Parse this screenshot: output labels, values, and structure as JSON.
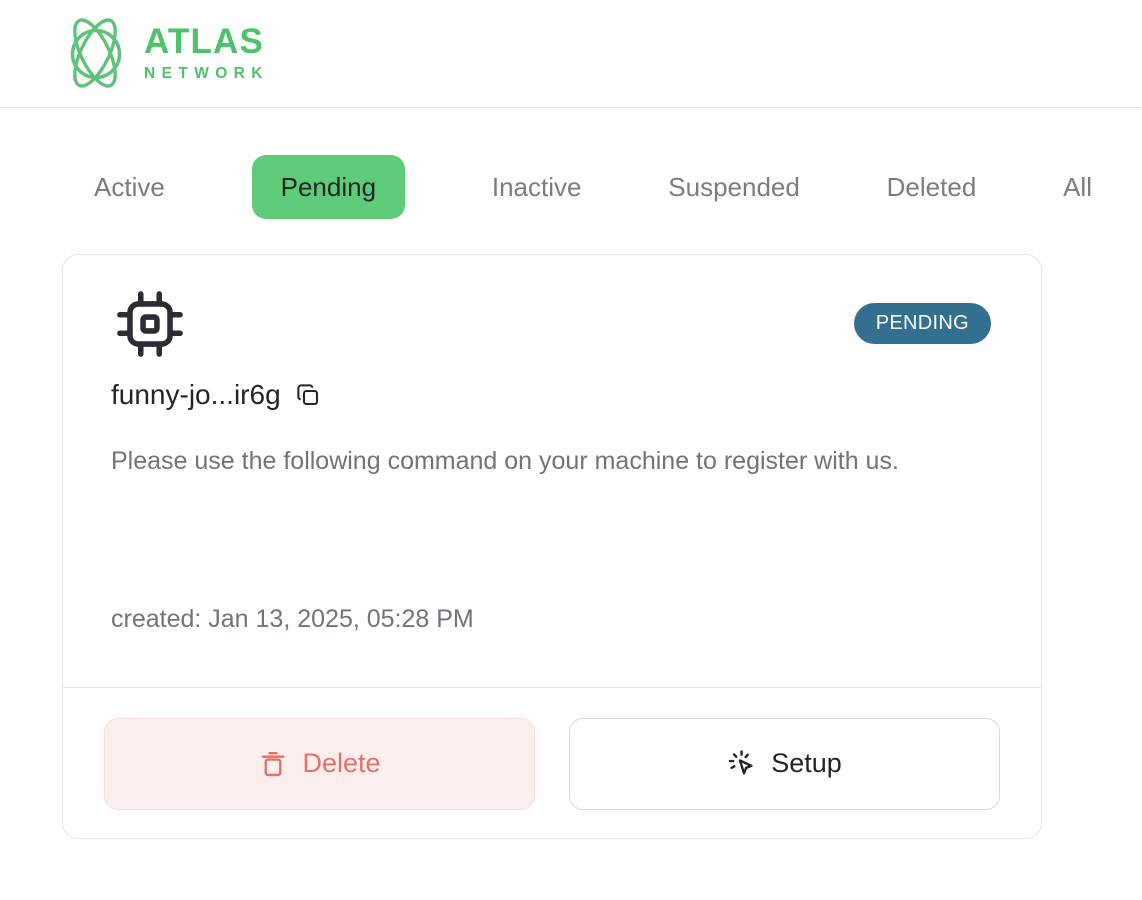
{
  "brand": {
    "logo_icon": "atom-orbit-icon",
    "title": "ATLAS",
    "subtitle": "NETWORK",
    "accent_color": "#4ec26a"
  },
  "tabs": [
    {
      "label": "Active",
      "active": false,
      "name": "tab-active"
    },
    {
      "label": "Pending",
      "active": true,
      "name": "tab-pending"
    },
    {
      "label": "Inactive",
      "active": false,
      "name": "tab-inactive"
    },
    {
      "label": "Suspended",
      "active": false,
      "name": "tab-suspended"
    },
    {
      "label": "Deleted",
      "active": false,
      "name": "tab-deleted"
    },
    {
      "label": "All",
      "active": false,
      "name": "tab-all"
    }
  ],
  "tab_active_bg": "#5ecb78",
  "device_card": {
    "device_icon": "cpu-chip-icon",
    "status_badge": {
      "label": "PENDING",
      "bg_color": "#337090",
      "text_color": "#ffffff"
    },
    "name": "funny-jo...ir6g",
    "copy_icon": "copy-icon",
    "description": "Please use the following command on your machine to register with us.",
    "created": "created: Jan 13, 2025, 05:28 PM",
    "actions": {
      "delete": {
        "label": "Delete",
        "icon": "trash-icon",
        "color": "#e2716a",
        "bg": "#fdeeee"
      },
      "setup": {
        "label": "Setup",
        "icon": "cursor-click-icon",
        "color": "#212529",
        "bg": "#ffffff"
      }
    }
  }
}
